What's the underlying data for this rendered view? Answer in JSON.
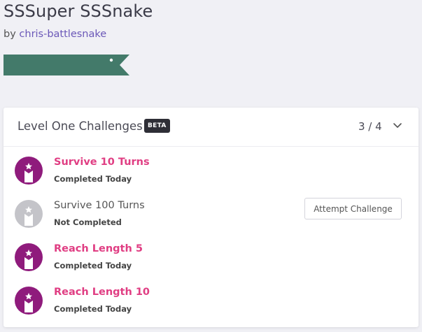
{
  "snake": {
    "title": "SSSuper SSSnake",
    "by_prefix": "by",
    "author": "chris-battlesnake",
    "color": "#437a6a"
  },
  "challenges": {
    "title": "Level One Challenges",
    "badge": "BETA",
    "progress": "3 / 4",
    "completed_color": "#e03e83",
    "items": [
      {
        "name": "Survive 10 Turns",
        "status": "Completed Today",
        "completed": true,
        "icon": "trophy-icon"
      },
      {
        "name": "Survive 100 Turns",
        "status": "Not Completed",
        "completed": false,
        "icon": "trophy-icon",
        "action": "Attempt Challenge"
      },
      {
        "name": "Reach Length 5",
        "status": "Completed Today",
        "completed": true,
        "icon": "trophy-icon"
      },
      {
        "name": "Reach Length 10",
        "status": "Completed Today",
        "completed": true,
        "icon": "trophy-icon"
      }
    ]
  }
}
